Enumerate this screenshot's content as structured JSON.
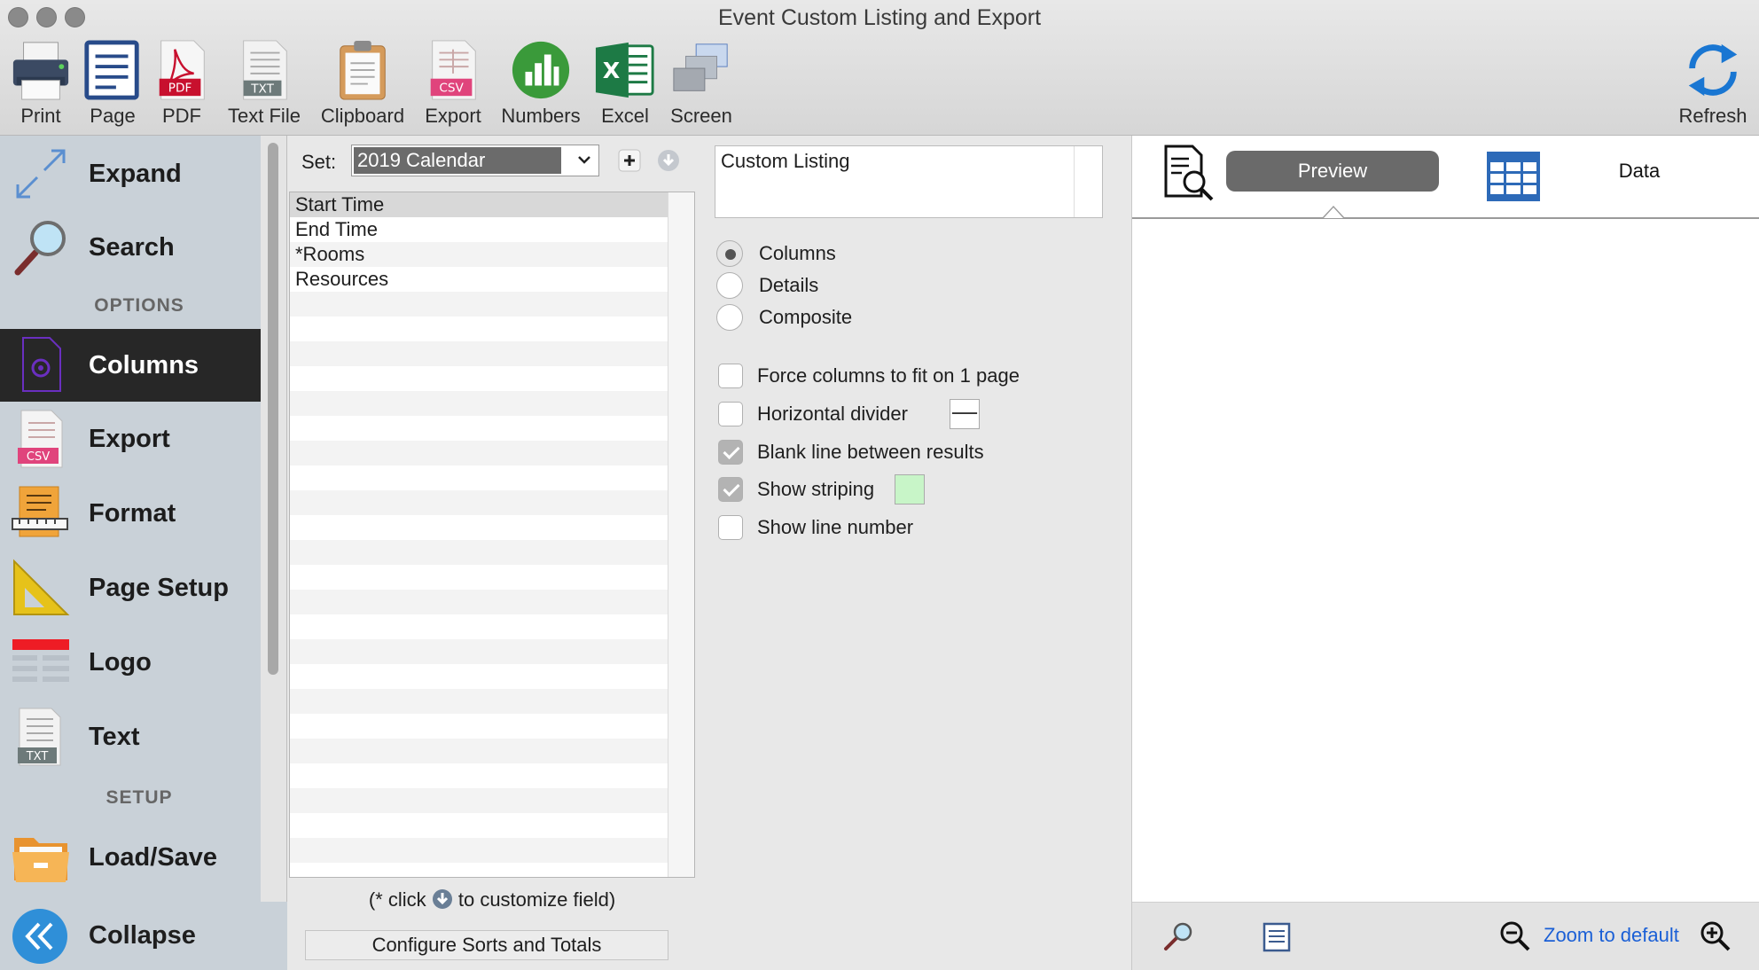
{
  "window": {
    "title": "Event Custom Listing and Export"
  },
  "toolbar": {
    "items": [
      {
        "label": "Print",
        "icon": "printer-icon"
      },
      {
        "label": "Page",
        "icon": "page-icon"
      },
      {
        "label": "PDF",
        "icon": "pdf-icon"
      },
      {
        "label": "Text File",
        "icon": "txt-file-icon"
      },
      {
        "label": "Clipboard",
        "icon": "clipboard-icon"
      },
      {
        "label": "Export",
        "icon": "csv-icon"
      },
      {
        "label": "Numbers",
        "icon": "numbers-icon"
      },
      {
        "label": "Excel",
        "icon": "excel-icon"
      },
      {
        "label": "Screen",
        "icon": "screen-icon"
      }
    ],
    "refresh_label": "Refresh"
  },
  "sidebar": {
    "items": [
      {
        "label": "Expand",
        "icon": "expand-icon"
      },
      {
        "label": "Search",
        "icon": "magnifier-icon"
      },
      {
        "label": "Columns",
        "icon": "columns-gear-icon",
        "active": true
      },
      {
        "label": "Export",
        "icon": "csv-icon"
      },
      {
        "label": "Format",
        "icon": "ruler-pencil-icon"
      },
      {
        "label": "Page Setup",
        "icon": "set-square-icon"
      },
      {
        "label": "Logo",
        "icon": "logo-icon"
      },
      {
        "label": "Text",
        "icon": "txt-icon"
      },
      {
        "label": "Load/Save",
        "icon": "folder-icon"
      }
    ],
    "sections": {
      "options": "OPTIONS",
      "setup": "SETUP"
    },
    "collapse_label": "Collapse"
  },
  "fields": {
    "set_label": "Set:",
    "set_value": "2019 Calendar",
    "list": [
      "Start Time",
      "End Time",
      "*Rooms",
      "Resources"
    ],
    "hint_before": "(* click",
    "hint_after": "to customize field)",
    "configure_label": "Configure Sorts and Totals"
  },
  "options": {
    "listing_title": "Custom Listing",
    "layout": [
      {
        "label": "Columns",
        "selected": true
      },
      {
        "label": "Details",
        "selected": false
      },
      {
        "label": "Composite",
        "selected": false
      }
    ],
    "checks": [
      {
        "label": "Force columns to fit on 1 page",
        "checked": false
      },
      {
        "label": "Horizontal divider",
        "checked": false
      },
      {
        "label": "Blank line between results",
        "checked": true
      },
      {
        "label": "Show striping",
        "checked": true
      },
      {
        "label": "Show line number",
        "checked": false
      }
    ],
    "striping_color": "#c8f5c8"
  },
  "preview": {
    "tabs": [
      {
        "label": "Preview",
        "active": true
      },
      {
        "label": "Data",
        "active": false
      }
    ],
    "zoom_label": "Zoom to default"
  },
  "colors": {
    "sidebar_bg": "#c9d1d8",
    "active_item_bg": "#272727",
    "accent_blue": "#2f8fd8",
    "link_blue": "#1a5fd6"
  }
}
